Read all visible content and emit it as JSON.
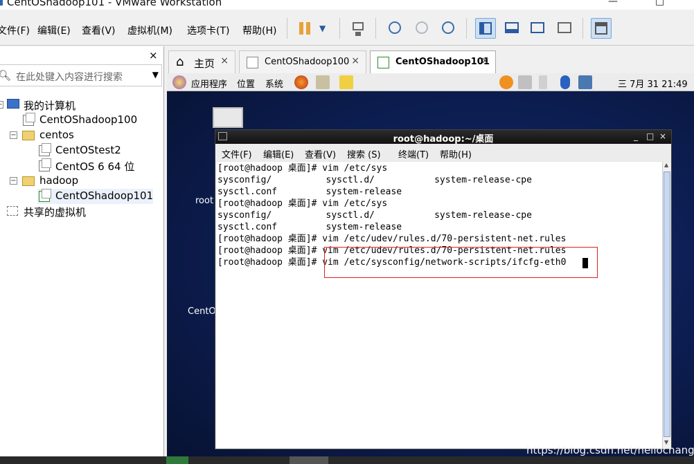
{
  "window": {
    "title": "CentOShadoop101 - VMware Workstation",
    "min": "—",
    "max": "□"
  },
  "menu": [
    "文件(F)",
    "编辑(E)",
    "查看(V)",
    "虚拟机(M)",
    "选项卡(T)",
    "帮助(H)"
  ],
  "sidebar": {
    "close": "×",
    "search_placeholder": "在此处键入内容进行搜索",
    "tree": [
      {
        "label": "我的计算机"
      },
      {
        "label": "CentOShadoop100"
      },
      {
        "label": "centos"
      },
      {
        "label": "CentOStest2"
      },
      {
        "label": "CentOS 6 64 位"
      },
      {
        "label": "hadoop"
      },
      {
        "label": "CentOShadoop101"
      },
      {
        "label": "共享的虚拟机"
      }
    ],
    "expand_minus": "−"
  },
  "tabs": [
    {
      "label": "主页"
    },
    {
      "label": "CentOShadoop100"
    },
    {
      "label": "CentOShadoop101"
    }
  ],
  "tab_close": "×",
  "guest_panel": {
    "apps": "应用程序",
    "places": "位置",
    "system": "系统",
    "clock": "三 7月 31 21:49"
  },
  "desktop": {
    "icon1": "root",
    "icon2": "CentO"
  },
  "terminal": {
    "title": "root@hadoop:~/桌面",
    "win_buttons": [
      "_",
      "□",
      "×"
    ],
    "menu": [
      "文件(F)",
      "编辑(E)",
      "查看(V)",
      "搜索 (S)",
      "终端(T)",
      "帮助(H)"
    ],
    "lines": [
      "[root@hadoop 桌面]# vim /etc/sys",
      "sysconfig/          sysctl.d/           system-release-cpe",
      "sysctl.conf         system-release",
      "[root@hadoop 桌面]# vim /etc/sys",
      "sysconfig/          sysctl.d/           system-release-cpe",
      "sysctl.conf         system-release",
      "[root@hadoop 桌面]# vim /etc/udev/rules.d/70-persistent-net.rules",
      "[root@hadoop 桌面]# vim /etc/udev/rules.d/70-persistent-net.rules",
      "[root@hadoop 桌面]# vim /etc/sysconfig/network-scripts/ifcfg-eth0"
    ]
  },
  "watermark": "https://blog.csdn.net/heiiochange",
  "colors": {
    "highlight_box": "#e02020",
    "desktop_bg": "#0d1f55",
    "accent": "#2a66b0"
  }
}
